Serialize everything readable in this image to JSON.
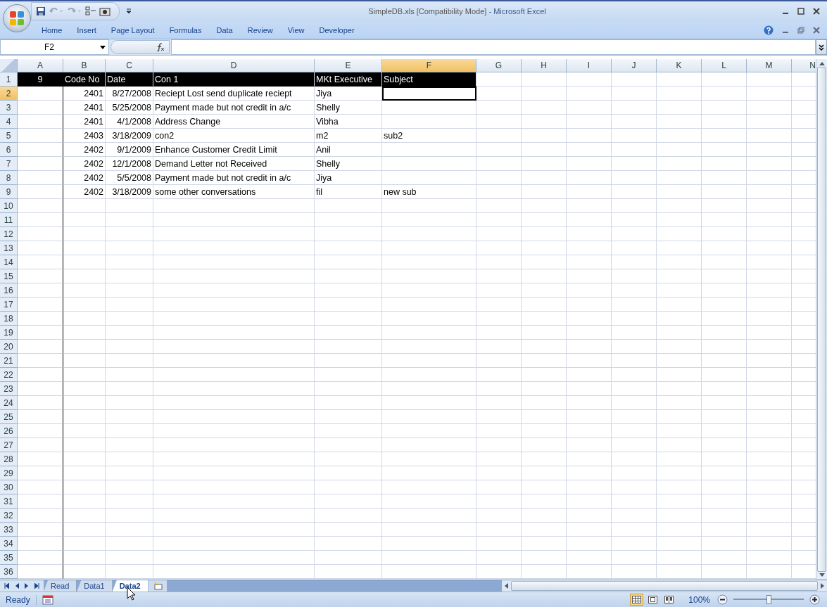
{
  "window": {
    "title_file": "SimpleDB.xls  [Compatibility Mode]",
    "title_app": " - Microsoft Excel"
  },
  "ribbon_tabs": [
    "Home",
    "Insert",
    "Page Layout",
    "Formulas",
    "Data",
    "Review",
    "View",
    "Developer"
  ],
  "name_box": "F2",
  "columns": [
    {
      "label": "A",
      "selected": false
    },
    {
      "label": "B",
      "selected": false
    },
    {
      "label": "C",
      "selected": false
    },
    {
      "label": "D",
      "selected": false
    },
    {
      "label": "E",
      "selected": false
    },
    {
      "label": "F",
      "selected": true
    },
    {
      "label": "G",
      "selected": false
    },
    {
      "label": "H",
      "selected": false
    },
    {
      "label": "I",
      "selected": false
    },
    {
      "label": "J",
      "selected": false
    },
    {
      "label": "K",
      "selected": false
    },
    {
      "label": "L",
      "selected": false
    },
    {
      "label": "M",
      "selected": false
    },
    {
      "label": "N",
      "selected": false
    }
  ],
  "rows": [
    {
      "number": "1",
      "selected": false,
      "kind": "header",
      "cells": [
        {
          "kind": "center",
          "text": "9"
        },
        {
          "kind": "text",
          "text": "Code No"
        },
        {
          "kind": "text",
          "text": "Date"
        },
        {
          "kind": "text",
          "text": "Con 1"
        },
        {
          "kind": "text",
          "text": "MKt Executive"
        },
        {
          "kind": "text",
          "text": "Subject"
        }
      ]
    },
    {
      "number": "2",
      "selected": true,
      "kind": "data",
      "cells": [
        null,
        {
          "kind": "number",
          "text": "2401"
        },
        {
          "kind": "number",
          "text": "8/27/2008"
        },
        {
          "kind": "text",
          "text": "Reciept Lost send duplicate reciept"
        },
        {
          "kind": "text",
          "text": "Jiya"
        }
      ]
    },
    {
      "number": "3",
      "selected": false,
      "kind": "data",
      "cells": [
        null,
        {
          "kind": "number",
          "text": "2401"
        },
        {
          "kind": "number",
          "text": "5/25/2008"
        },
        {
          "kind": "text",
          "text": "Payment made but not credit in a/c"
        },
        {
          "kind": "text",
          "text": "Shelly"
        }
      ]
    },
    {
      "number": "4",
      "selected": false,
      "kind": "data",
      "cells": [
        null,
        {
          "kind": "number",
          "text": "2401"
        },
        {
          "kind": "number",
          "text": "4/1/2008"
        },
        {
          "kind": "text",
          "text": "Address Change"
        },
        {
          "kind": "text",
          "text": "Vibha"
        }
      ]
    },
    {
      "number": "5",
      "selected": false,
      "kind": "data",
      "cells": [
        null,
        {
          "kind": "number",
          "text": "2403"
        },
        {
          "kind": "number",
          "text": "3/18/2009"
        },
        {
          "kind": "text",
          "text": "con2"
        },
        {
          "kind": "text",
          "text": "m2"
        },
        {
          "kind": "text",
          "text": "sub2"
        }
      ]
    },
    {
      "number": "6",
      "selected": false,
      "kind": "data",
      "cells": [
        null,
        {
          "kind": "number",
          "text": "2402"
        },
        {
          "kind": "number",
          "text": "9/1/2009"
        },
        {
          "kind": "text",
          "text": "Enhance Customer Credit Limit"
        },
        {
          "kind": "text",
          "text": "Anil"
        }
      ]
    },
    {
      "number": "7",
      "selected": false,
      "kind": "data",
      "cells": [
        null,
        {
          "kind": "number",
          "text": "2402"
        },
        {
          "kind": "number",
          "text": "12/1/2008"
        },
        {
          "kind": "text",
          "text": "Demand Letter not Received"
        },
        {
          "kind": "text",
          "text": "Shelly"
        }
      ]
    },
    {
      "number": "8",
      "selected": false,
      "kind": "data",
      "cells": [
        null,
        {
          "kind": "number",
          "text": "2402"
        },
        {
          "kind": "number",
          "text": "5/5/2008"
        },
        {
          "kind": "text",
          "text": "Payment made but not credit in a/c"
        },
        {
          "kind": "text",
          "text": "Jiya"
        }
      ]
    },
    {
      "number": "9",
      "selected": false,
      "kind": "data",
      "cells": [
        null,
        {
          "kind": "number",
          "text": "2402"
        },
        {
          "kind": "number",
          "text": "3/18/2009"
        },
        {
          "kind": "text",
          "text": "some other conversations"
        },
        {
          "kind": "text",
          "text": "fil"
        },
        {
          "kind": "text",
          "text": "new sub"
        }
      ]
    },
    {
      "number": "10",
      "selected": false,
      "kind": "data",
      "cells": []
    },
    {
      "number": "11",
      "selected": false,
      "kind": "data",
      "cells": []
    },
    {
      "number": "12",
      "selected": false,
      "kind": "data",
      "cells": []
    },
    {
      "number": "13",
      "selected": false,
      "kind": "data",
      "cells": []
    },
    {
      "number": "14",
      "selected": false,
      "kind": "data",
      "cells": []
    },
    {
      "number": "15",
      "selected": false,
      "kind": "data",
      "cells": []
    },
    {
      "number": "16",
      "selected": false,
      "kind": "data",
      "cells": []
    },
    {
      "number": "17",
      "selected": false,
      "kind": "data",
      "cells": []
    },
    {
      "number": "18",
      "selected": false,
      "kind": "data",
      "cells": []
    },
    {
      "number": "19",
      "selected": false,
      "kind": "data",
      "cells": []
    },
    {
      "number": "20",
      "selected": false,
      "kind": "data",
      "cells": []
    },
    {
      "number": "21",
      "selected": false,
      "kind": "data",
      "cells": []
    },
    {
      "number": "22",
      "selected": false,
      "kind": "data",
      "cells": []
    },
    {
      "number": "23",
      "selected": false,
      "kind": "data",
      "cells": []
    },
    {
      "number": "24",
      "selected": false,
      "kind": "data",
      "cells": []
    },
    {
      "number": "25",
      "selected": false,
      "kind": "data",
      "cells": []
    },
    {
      "number": "26",
      "selected": false,
      "kind": "data",
      "cells": []
    },
    {
      "number": "27",
      "selected": false,
      "kind": "data",
      "cells": []
    },
    {
      "number": "28",
      "selected": false,
      "kind": "data",
      "cells": []
    },
    {
      "number": "29",
      "selected": false,
      "kind": "data",
      "cells": []
    },
    {
      "number": "30",
      "selected": false,
      "kind": "data",
      "cells": []
    },
    {
      "number": "31",
      "selected": false,
      "kind": "data",
      "cells": []
    },
    {
      "number": "32",
      "selected": false,
      "kind": "data",
      "cells": []
    },
    {
      "number": "33",
      "selected": false,
      "kind": "data",
      "cells": []
    },
    {
      "number": "34",
      "selected": false,
      "kind": "data",
      "cells": []
    },
    {
      "number": "35",
      "selected": false,
      "kind": "data",
      "cells": []
    },
    {
      "number": "36",
      "selected": false,
      "kind": "data",
      "cells": []
    }
  ],
  "sheet_tabs": [
    {
      "label": "Read",
      "selected": false
    },
    {
      "label": "Data1",
      "selected": false
    },
    {
      "label": "Data2",
      "selected": true
    }
  ],
  "status_bar": {
    "status": "Ready",
    "views": [
      {
        "kind": "normal",
        "selected": true
      },
      {
        "kind": "page-layout",
        "selected": false
      },
      {
        "kind": "page-break",
        "selected": false
      }
    ],
    "zoom": "100%",
    "zoom_slider": {
      "level": 0.5
    }
  }
}
